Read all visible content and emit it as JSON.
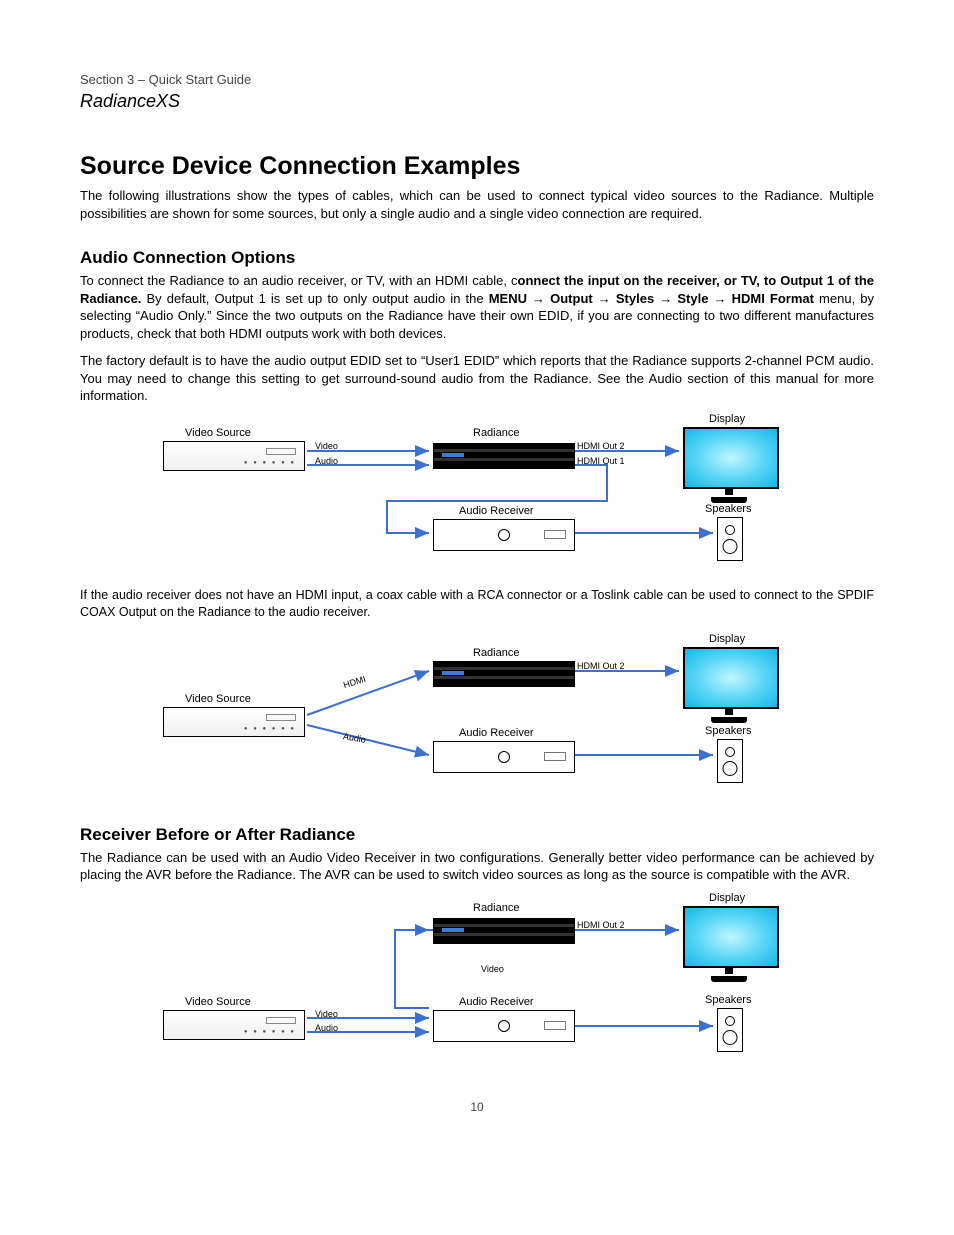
{
  "header": {
    "section": "Section 3 – Quick Start Guide",
    "model": "RadianceXS"
  },
  "intro_heading": "Source Device Connection Examples",
  "intro_body": "The following illustrations show the types of cables, which can be used to connect typical video sources to the Radiance. Multiple possibilities are shown for some sources, but only a single audio and a single video connection are required.",
  "audio_heading": "Audio Connection Options",
  "audio_body_a": "To connect the Radiance to an audio receiver, or TV, with an HDMI cable, c",
  "audio_body_b": "onnect the input on the receiver, or TV, to Output 1 of the Radiance.",
  "audio_body_c": " By default, Output 1 is set up to only output audio in the",
  "audio_body_d": "MENU → Output → Styles → Style → HDMI Format",
  "audio_body_e": "menu, by selecting “Audio Only.” Since the two outputs on the Radiance have their own EDID, if you are connecting to two different manufactures products, check that both HDMI outputs work with both devices.",
  "default_text": "The factory default is to have the audio output EDID set to “User1 EDID” which reports that the Radiance supports 2-channel PCM audio. You may need to change this setting to get surround-sound audio from the Radiance. See the Audio section of this manual for more information.",
  "fig1": {
    "video_source": "Video Source",
    "radiance": "Radiance",
    "audio_receiver": "Audio Receiver",
    "display": "Display",
    "speakers": "Speakers",
    "video": "Video",
    "audio": "Audio",
    "out1": "HDMI Out 1",
    "out2": "HDMI Out 2"
  },
  "coax_body": "If the audio receiver does not have an HDMI input, a coax cable with a RCA connector or a Toslink cable can be used to connect to the SPDIF COAX Output on the Radiance to the audio receiver.",
  "fig2": {
    "video_source": "Video Source",
    "radiance": "Radiance",
    "audio_receiver": "Audio Receiver",
    "display": "Display",
    "speakers": "Speakers",
    "hdmi": "HDMI",
    "audio": "Audio",
    "out2": "HDMI Out 2"
  },
  "avr_heading": "Receiver Before or After Radiance",
  "avr_body": "The Radiance can be used with an Audio Video Receiver in two configurations. Generally better video performance can be achieved by placing the AVR before the Radiance. The AVR can be used to switch video sources as long as the source is compatible with the AVR.",
  "fig3": {
    "video_source": "Video Source",
    "radiance": "Radiance",
    "audio_receiver": "Audio Receiver",
    "display": "Display",
    "speakers": "Speakers",
    "video_top": "Video",
    "video": "Video",
    "audio": "Audio",
    "out2": "HDMI Out 2"
  },
  "footer": "10"
}
